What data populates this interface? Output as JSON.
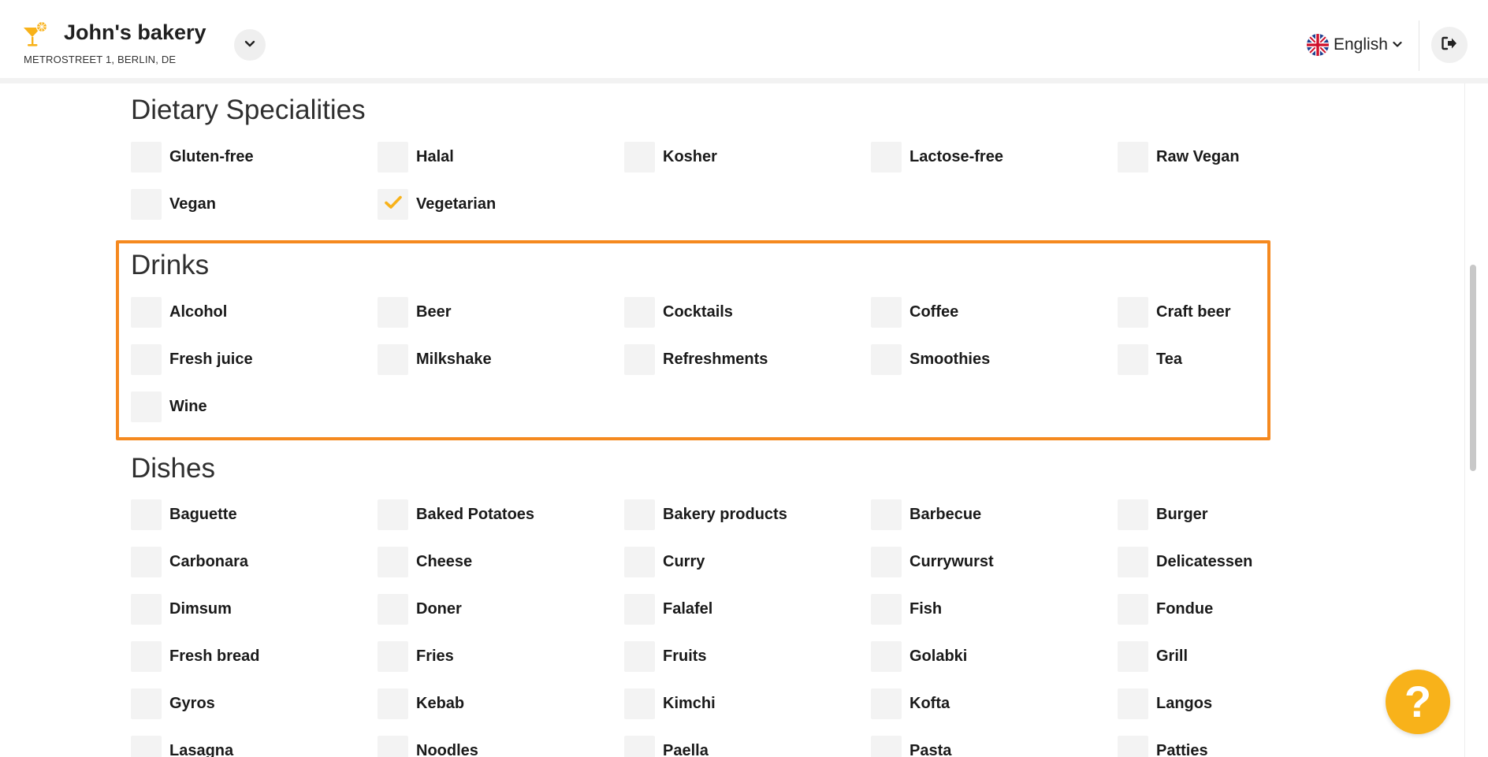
{
  "business": {
    "name": "John's bakery",
    "address": "METROSTREET 1, BERLIN, DE"
  },
  "language": {
    "selected": "English"
  },
  "sections": {
    "dietary": {
      "title": "Dietary Specialities",
      "options": [
        {
          "label": "Gluten-free",
          "checked": false
        },
        {
          "label": "Halal",
          "checked": false
        },
        {
          "label": "Kosher",
          "checked": false
        },
        {
          "label": "Lactose-free",
          "checked": false
        },
        {
          "label": "Raw Vegan",
          "checked": false
        },
        {
          "label": "Vegan",
          "checked": false
        },
        {
          "label": "Vegetarian",
          "checked": true
        }
      ]
    },
    "drinks": {
      "title": "Drinks",
      "options": [
        {
          "label": "Alcohol",
          "checked": false
        },
        {
          "label": "Beer",
          "checked": false
        },
        {
          "label": "Cocktails",
          "checked": false
        },
        {
          "label": "Coffee",
          "checked": false
        },
        {
          "label": "Craft beer",
          "checked": false
        },
        {
          "label": "Fresh juice",
          "checked": false
        },
        {
          "label": "Milkshake",
          "checked": false
        },
        {
          "label": "Refreshments",
          "checked": false
        },
        {
          "label": "Smoothies",
          "checked": false
        },
        {
          "label": "Tea",
          "checked": false
        },
        {
          "label": "Wine",
          "checked": false
        }
      ]
    },
    "dishes": {
      "title": "Dishes",
      "options": [
        {
          "label": "Baguette",
          "checked": false
        },
        {
          "label": "Baked Potatoes",
          "checked": false
        },
        {
          "label": "Bakery products",
          "checked": false
        },
        {
          "label": "Barbecue",
          "checked": false
        },
        {
          "label": "Burger",
          "checked": false
        },
        {
          "label": "Carbonara",
          "checked": false
        },
        {
          "label": "Cheese",
          "checked": false
        },
        {
          "label": "Curry",
          "checked": false
        },
        {
          "label": "Currywurst",
          "checked": false
        },
        {
          "label": "Delicatessen",
          "checked": false
        },
        {
          "label": "Dimsum",
          "checked": false
        },
        {
          "label": "Doner",
          "checked": false
        },
        {
          "label": "Falafel",
          "checked": false
        },
        {
          "label": "Fish",
          "checked": false
        },
        {
          "label": "Fondue",
          "checked": false
        },
        {
          "label": "Fresh bread",
          "checked": false
        },
        {
          "label": "Fries",
          "checked": false
        },
        {
          "label": "Fruits",
          "checked": false
        },
        {
          "label": "Golabki",
          "checked": false
        },
        {
          "label": "Grill",
          "checked": false
        },
        {
          "label": "Gyros",
          "checked": false
        },
        {
          "label": "Kebab",
          "checked": false
        },
        {
          "label": "Kimchi",
          "checked": false
        },
        {
          "label": "Kofta",
          "checked": false
        },
        {
          "label": "Langos",
          "checked": false
        },
        {
          "label": "Lasagna",
          "checked": false
        },
        {
          "label": "Noodles",
          "checked": false
        },
        {
          "label": "Paella",
          "checked": false
        },
        {
          "label": "Pasta",
          "checked": false
        },
        {
          "label": "Patties",
          "checked": false
        }
      ]
    }
  },
  "colors": {
    "accent": "#f5891f",
    "check": "#f8b21a",
    "help": "#f8b21a"
  },
  "icons": {
    "logo": "cocktail-glass-icon",
    "business_toggle": "chevron-down-icon",
    "language": "uk-flag-icon",
    "logout": "logout-icon",
    "help": "question-mark-icon",
    "checked": "checkmark-icon"
  },
  "help": {
    "label": "?"
  }
}
